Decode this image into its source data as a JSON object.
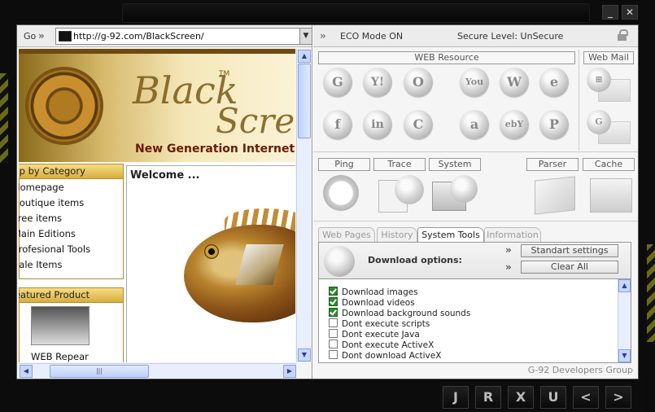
{
  "window": {
    "minimize_glyph": "_",
    "close_glyph": "✕"
  },
  "browser": {
    "go_label": "Go",
    "go_arrows": "»",
    "url": "http://g-92.com/BlackScreen/",
    "page": {
      "brand_black": "Black",
      "brand_screen": "Screen",
      "brand_tm": "TM",
      "tagline": "New Generation Internet Tools",
      "category_header": "Shop by Category",
      "categories": [
        "Homepage",
        "Boutique items",
        "Free items",
        "Main Editions",
        "Profesional Tools",
        "Sale Items"
      ],
      "featured_header": "Featured Product",
      "featured_label": "WEB Repear",
      "welcome": "Welcome ..."
    }
  },
  "panel": {
    "eco_arrows": "»",
    "eco_mode": "ECO Mode ON",
    "secure_level": "Secure Level: UnSecure",
    "web_resource_label": "WEB Resource",
    "web_mail_label": "Web Mail",
    "web_resource_icons": [
      {
        "name": "google",
        "glyph": "G"
      },
      {
        "name": "yahoo",
        "glyph": "Y!"
      },
      {
        "name": "opera",
        "glyph": "O"
      },
      {
        "name": "youtube",
        "glyph": "You"
      },
      {
        "name": "wordpress",
        "glyph": "W"
      },
      {
        "name": "ie",
        "glyph": "e"
      },
      {
        "name": "facebook",
        "glyph": "f"
      },
      {
        "name": "linkedin",
        "glyph": "in"
      },
      {
        "name": "chrome",
        "glyph": "C"
      },
      {
        "name": "amazon",
        "glyph": "a"
      },
      {
        "name": "ebay",
        "glyph": "ebY"
      },
      {
        "name": "paypal",
        "glyph": "P"
      }
    ],
    "web_mail_icons": [
      {
        "name": "windows-mail",
        "glyph": "⊞"
      },
      {
        "name": "gmail",
        "glyph": "G"
      }
    ],
    "tools": {
      "ping": "Ping",
      "trace": "Trace",
      "system": "System",
      "parser": "Parser",
      "cache": "Cache"
    },
    "tabs": [
      "Web Pages",
      "History",
      "System Tools",
      "Information"
    ],
    "active_tab": "System Tools",
    "download_options_label": "Download options:",
    "standart_settings": "Standart settings",
    "clear_all": "Clear All",
    "options": [
      {
        "label": "Download images",
        "checked": true
      },
      {
        "label": "Download videos",
        "checked": true
      },
      {
        "label": "Download background sounds",
        "checked": true
      },
      {
        "label": "Dont execute scripts",
        "checked": false
      },
      {
        "label": "Dont execute Java",
        "checked": false
      },
      {
        "label": "Dont execute ActiveX",
        "checked": false
      },
      {
        "label": "Dont download ActiveX",
        "checked": false
      }
    ],
    "footer": "G-92 Developers Group"
  },
  "nav_buttons": [
    "J",
    "R",
    "X",
    "U",
    "<",
    ">"
  ],
  "colors": {
    "accent_gold": "#d8ae3f",
    "checkbox_green": "#2f8a2f"
  }
}
